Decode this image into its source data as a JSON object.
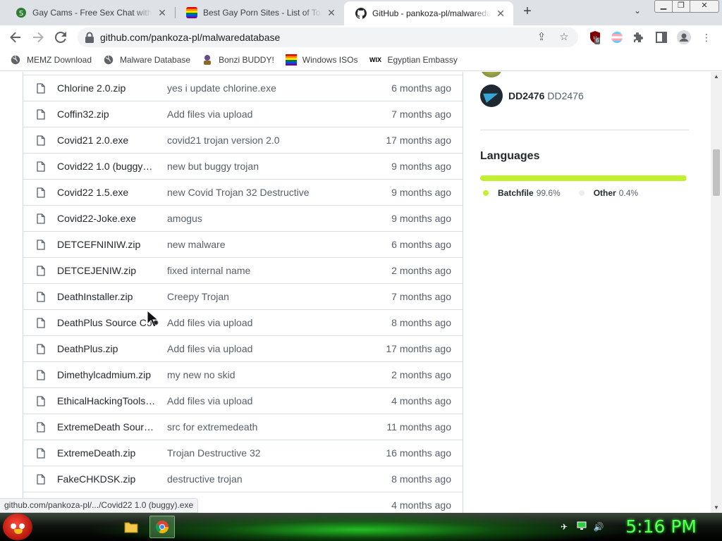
{
  "browser": {
    "tabs": [
      {
        "title": "Gay Cams - Free Sex Chat with Se",
        "favicon": "green-site-icon",
        "active": false
      },
      {
        "title": "Best Gay Porn Sites - List of Top G",
        "favicon": "rainbow-flag-icon",
        "active": false
      },
      {
        "title": "GitHub - pankoza-pl/malwaredat",
        "favicon": "github-icon",
        "active": true
      }
    ],
    "new_tab": "+",
    "tab_search": "⌄",
    "url": "github.com/pankoza-pl/malwaredatabase",
    "extension_badge": "6",
    "bookmarks": [
      {
        "label": "MEMZ Download",
        "icon": "globe-icon"
      },
      {
        "label": "Malware Database",
        "icon": "globe-icon"
      },
      {
        "label": "Bonzi BUDDY!",
        "icon": "bonzi-icon"
      },
      {
        "label": "Windows ISOs",
        "icon": "rainbow-flag-icon"
      },
      {
        "label": "Egyptian Embassy",
        "icon": "wix-icon",
        "icon_text": "WIX"
      }
    ]
  },
  "files": [
    {
      "name": "Chlorine 2.0.zip",
      "message": "yes i update chlorine.exe",
      "age": "6 months ago"
    },
    {
      "name": "Coffin32.zip",
      "message": "Add files via upload",
      "age": "7 months ago"
    },
    {
      "name": "Covid21 2.0.exe",
      "message": "covid21 trojan version 2.0",
      "age": "17 months ago"
    },
    {
      "name": "Covid22 1.0 (buggy)....",
      "message": "new but buggy trojan",
      "age": "9 months ago"
    },
    {
      "name": "Covid22 1.5.exe",
      "message": "new Covid Trojan 32 Destructive",
      "age": "9 months ago"
    },
    {
      "name": "Covid22-Joke.exe",
      "message": "amogus",
      "age": "9 months ago"
    },
    {
      "name": "DETCEFNINIW.zip",
      "message": "new malware",
      "age": "6 months ago"
    },
    {
      "name": "DETCEJENIW.zip",
      "message": "fixed internal name",
      "age": "2 months ago"
    },
    {
      "name": "DeathInstaller.zip",
      "message": "Creepy Trojan",
      "age": "7 months ago"
    },
    {
      "name": "DeathPlus Source Co",
      "message": "Add files via upload",
      "age": "8 months ago"
    },
    {
      "name": "DeathPlus.zip",
      "message": "Add files via upload",
      "age": "17 months ago"
    },
    {
      "name": "Dimethylcadmium.zip",
      "message": "my new no skid",
      "age": "2 months ago"
    },
    {
      "name": "EthicalHackingTools ...",
      "message": "Add files via upload",
      "age": "4 months ago"
    },
    {
      "name": "ExtremeDeath Sourc...",
      "message": "src for extremedeath",
      "age": "11 months ago"
    },
    {
      "name": "ExtremeDeath.zip",
      "message": "Trojan Destructive 32",
      "age": "16 months ago"
    },
    {
      "name": "FakeCHKDSK.zip",
      "message": "destructive trojan",
      "age": "8 months ago"
    },
    {
      "name": "",
      "message": "mware",
      "age": "4 months ago"
    }
  ],
  "sidebar": {
    "contributor": {
      "login": "DD2476",
      "name": "DD2476"
    },
    "languages_heading": "Languages",
    "languages": [
      {
        "name": "Batchfile",
        "percent": "99.6%",
        "share": 99.6,
        "color": "#C1F12E"
      },
      {
        "name": "Other",
        "percent": "0.4%",
        "share": 0.4,
        "color": "#EDEDED"
      }
    ]
  },
  "status_url": "github.com/pankoza-pl/.../Covid22 1.0 (buggy).exe",
  "taskbar": {
    "clock": "5:16 PM"
  }
}
